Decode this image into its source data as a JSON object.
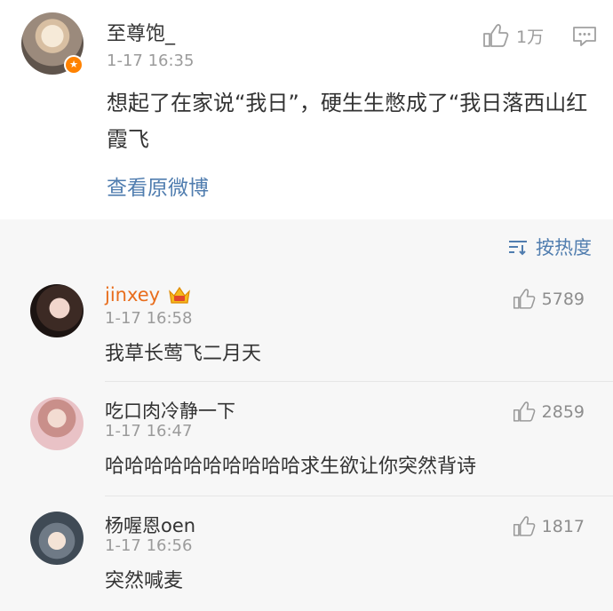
{
  "post": {
    "username": "至尊饱_",
    "time": "1-17 16:35",
    "like_count": "1万",
    "text": "想起了在家说“我日”，硬生生憋成了“我日落西山红霞飞",
    "view_original": "查看原微博"
  },
  "sort": {
    "label": "按热度"
  },
  "comments": [
    {
      "username": "jinxey",
      "time": "1-17 16:58",
      "likes": "5789",
      "text": "我草长莺飞二月天"
    },
    {
      "username": "吃口肉冷静一下",
      "time": "1-17 16:47",
      "likes": "2859",
      "text": "哈哈哈哈哈哈哈哈哈哈求生欲让你突然背诗"
    },
    {
      "username": "杨喔恩oen",
      "time": "1-17 16:56",
      "likes": "1817",
      "text": "突然喊麦"
    }
  ],
  "colors": {
    "link": "#507daf",
    "vip_name": "#e86d1c",
    "badge": "#ff8200"
  }
}
